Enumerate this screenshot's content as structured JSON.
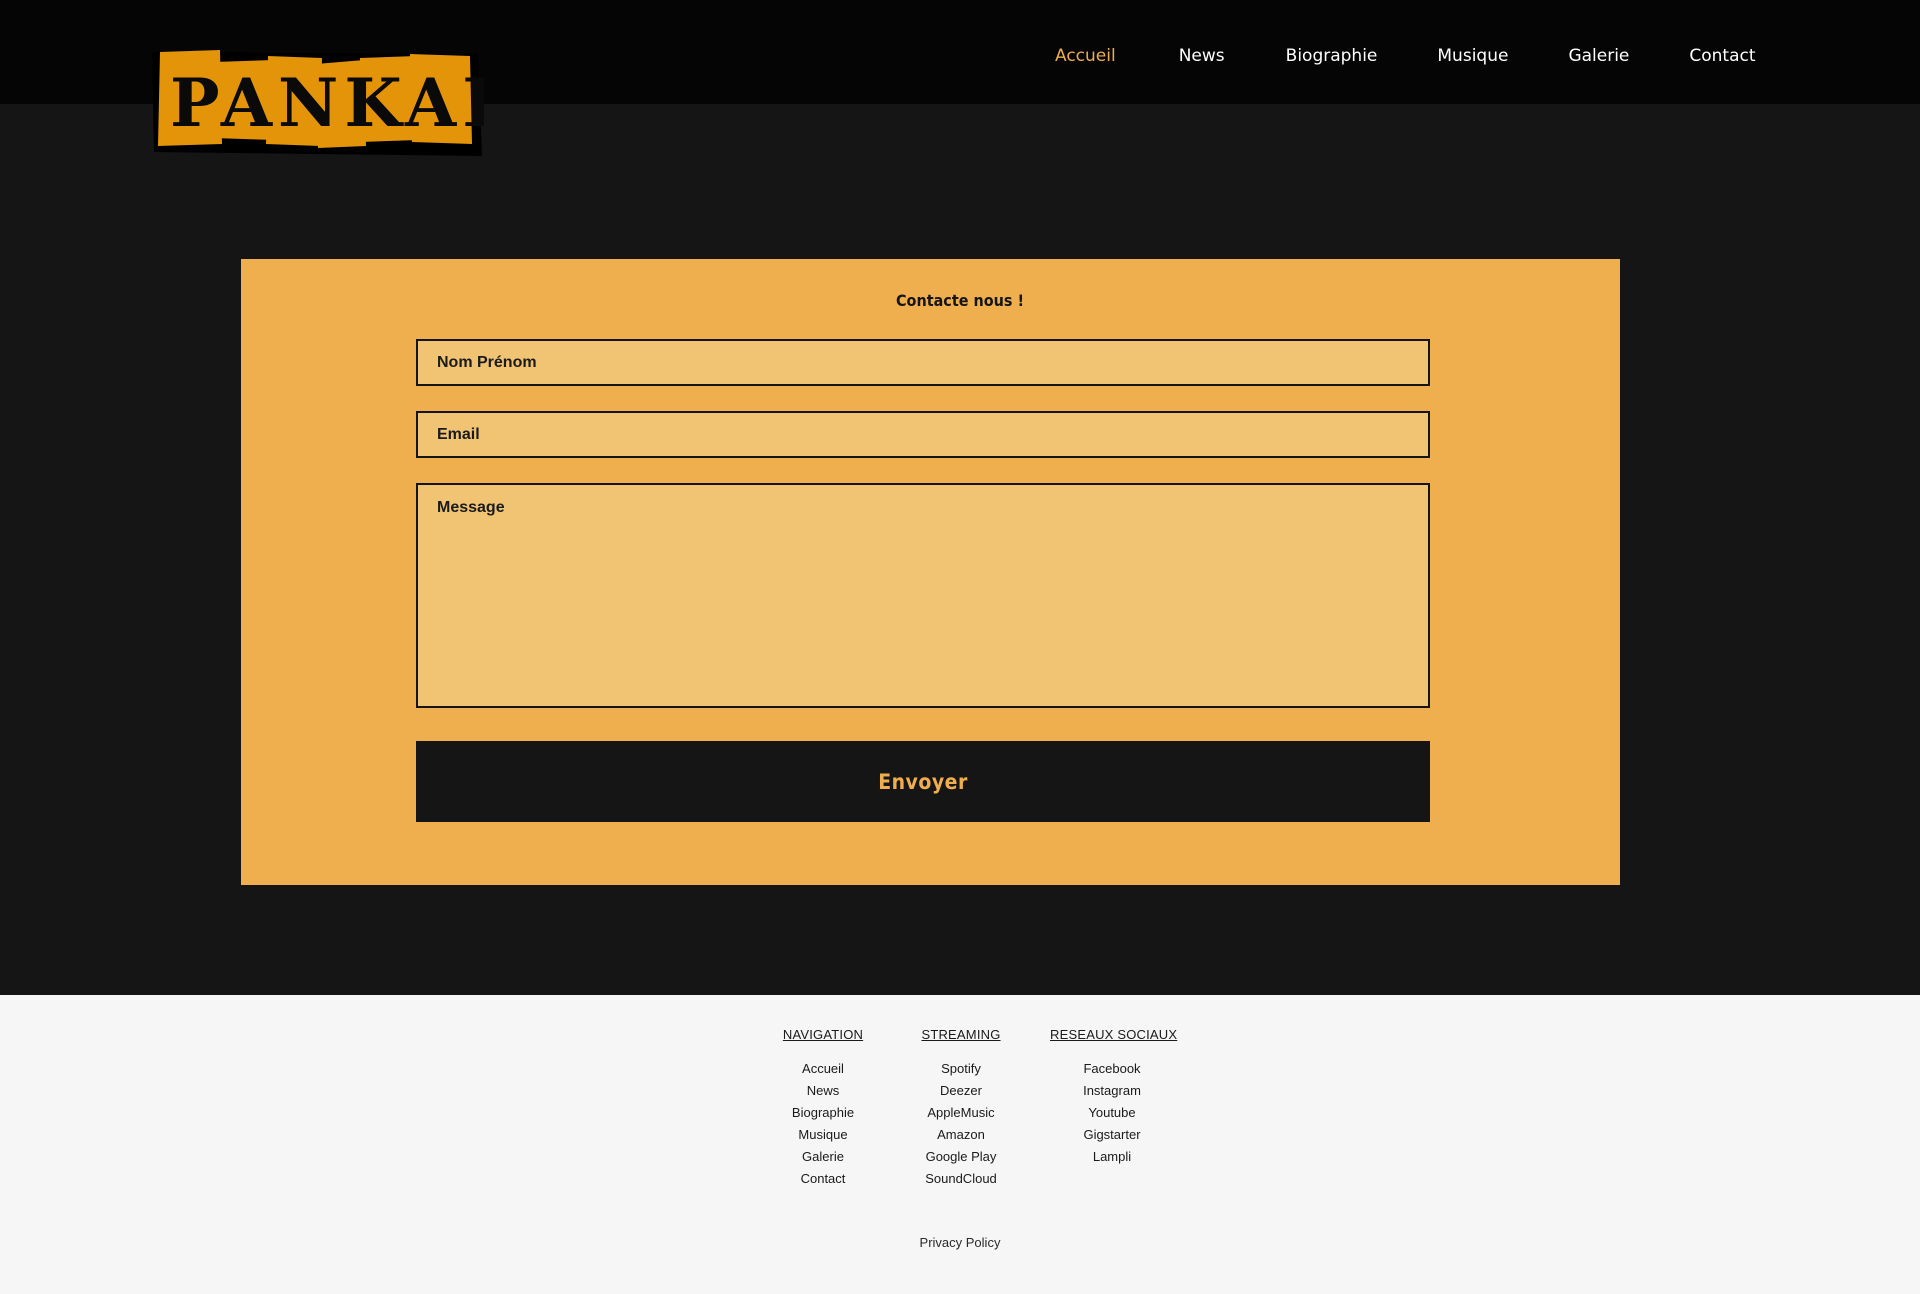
{
  "brand": {
    "logo_text": "PANKART",
    "accent_color": "#f0ad4e"
  },
  "nav": {
    "items": [
      {
        "label": "Accueil",
        "active": true
      },
      {
        "label": "News",
        "active": false
      },
      {
        "label": "Biographie",
        "active": false
      },
      {
        "label": "Musique",
        "active": false
      },
      {
        "label": "Galerie",
        "active": false
      },
      {
        "label": "Contact",
        "active": false
      }
    ]
  },
  "contact_form": {
    "title": "Contacte nous !",
    "name_placeholder": "Nom Prénom",
    "email_placeholder": "Email",
    "message_placeholder": "Message",
    "submit_label": "Envoyer"
  },
  "footer": {
    "navigation": {
      "heading": "NAVIGATION",
      "links": [
        "Accueil",
        "News",
        "Biographie",
        "Musique",
        "Galerie",
        "Contact"
      ]
    },
    "streaming": {
      "heading": "STREAMING",
      "links": [
        "Spotify",
        "Deezer",
        "AppleMusic",
        "Amazon",
        "Google Play",
        "SoundCloud"
      ]
    },
    "social": {
      "heading": "RESEAUX SOCIAUX",
      "links": [
        "Facebook",
        "Instagram",
        "Youtube",
        "Gigstarter",
        "Lampli"
      ]
    },
    "privacy_label": "Privacy Policy"
  }
}
